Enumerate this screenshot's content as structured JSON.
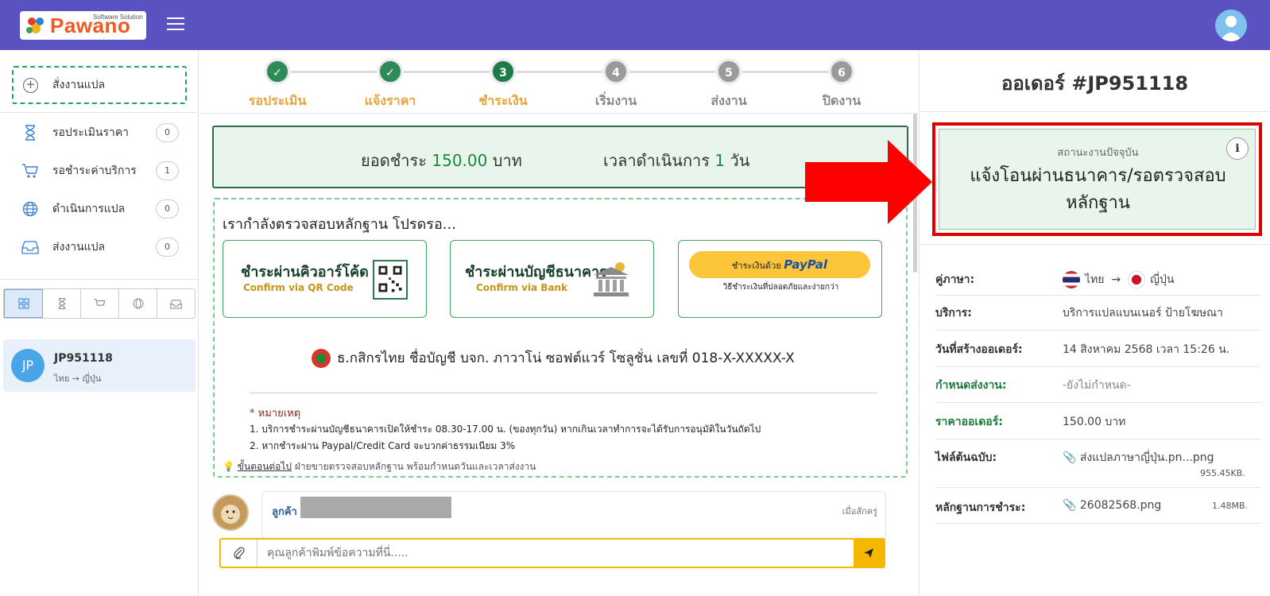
{
  "header": {
    "logo_text": "Pawano",
    "logo_sub": "Software Solution",
    "brand_color": "#5a52c0"
  },
  "sidebar": {
    "new_button": "สั่งงานแปล",
    "items": [
      {
        "label": "รอประเมินราคา",
        "count": "0",
        "icon": "hourglass-icon"
      },
      {
        "label": "รอชำระค่าบริการ",
        "count": "1",
        "icon": "cart-icon"
      },
      {
        "label": "ดำเนินการแปล",
        "count": "0",
        "icon": "globe-icon"
      },
      {
        "label": "ส่งงานแปล",
        "count": "0",
        "icon": "inbox-icon"
      }
    ],
    "filter_icons": [
      "grid-icon",
      "hourglass-icon",
      "cart-icon",
      "globe-icon",
      "inbox-icon"
    ],
    "order": {
      "avatar": "JP",
      "id": "JP951118",
      "lang": "ไทย → ญี่ปุ่น"
    }
  },
  "steps": [
    {
      "num": "✓",
      "label": "รอประเมิน",
      "state": "done"
    },
    {
      "num": "✓",
      "label": "แจ้งราคา",
      "state": "done"
    },
    {
      "num": "3",
      "label": "ชำระเงิน",
      "state": "current"
    },
    {
      "num": "4",
      "label": "เริ่มงาน",
      "state": "todo"
    },
    {
      "num": "5",
      "label": "ส่งงาน",
      "state": "todo"
    },
    {
      "num": "6",
      "label": "ปิดงาน",
      "state": "todo"
    }
  ],
  "payment": {
    "amount_label": "ยอดชำระ",
    "amount": "150.00",
    "currency": "บาท",
    "duration_label": "เวลาดำเนินการ",
    "duration": "1",
    "duration_unit": "วัน"
  },
  "check": {
    "title": "เรากำลังตรวจสอบหลักฐาน โปรดรอ...",
    "qr_title": "ชำระผ่านคิวอาร์โค้ด",
    "qr_sub": "Confirm via QR Code",
    "bank_title": "ชำระผ่านบัญชีธนาคาร",
    "bank_sub": "Confirm via Bank",
    "paypal_pre": "ชำระเงินด้วย",
    "paypal_brand": "PayPal",
    "paypal_sub": "วิธีชำระเงินที่ปลอดภัยและง่ายกว่า",
    "bank_account": "ธ.กสิกรไทย ชื่อบัญชี บจก. ภาวาโน่ ซอฟต์แวร์ โซลูชั่น เลขที่ 018-X-XXXXX-X",
    "note_header": "* หมายเหตุ",
    "note_1": "1. บริการชำระผ่านบัญชีธนาคารเปิดให้ชำระ 08.30-17.00 น. (ของทุกวัน) หากเกินเวลาทำการจะได้รับการอนุมัติในวันถัดไป",
    "note_2": "2. หากชำระผ่าน Paypal/Credit Card จะบวกค่าธรรมเนียม 3%",
    "next_link": "ขั้นตอนต่อไป",
    "next_text": " ฝ่ายขายตรวจสอบหลักฐาน พร้อมกำหนดวันและเวลาส่งงาน"
  },
  "chat": {
    "who": "ลูกค้า",
    "when": "เมื่อสักครู่",
    "placeholder": "คุณลูกค้าพิมพ์ข้อความที่นี่....."
  },
  "order": {
    "title": "ออเดอร์ #JP951118",
    "status_label": "สถานะงานปัจจุบัน",
    "status_value": "แจ้งโอนผ่านธนาคาร/รอตรวจสอบหลักฐาน",
    "rows": {
      "pair_label": "คู่ภาษา:",
      "pair_from": "ไทย",
      "pair_to": "ญี่ปุ่น",
      "service_label": "บริการ:",
      "service": "บริการแปลแบนเนอร์ ป้ายโฆษณา",
      "created_label": "วันที่สร้างออเดอร์:",
      "created": "14 สิงหาคม 2568 เวลา 15:26 น.",
      "due_label": "กำหนดส่งงาน:",
      "due": "-ยังไม่กำหนด-",
      "price_label": "ราคาออเดอร์:",
      "price": "150.00 บาท",
      "file_label": "ไฟล์ต้นฉบับ:",
      "file": "ส่งแปลภาษาญี่ปุ่น.pn...png",
      "file_size": "955.45KB.",
      "proof_label": "หลักฐานการชำระ:",
      "proof": "26082568.png",
      "proof_size": "1.48MB."
    }
  }
}
